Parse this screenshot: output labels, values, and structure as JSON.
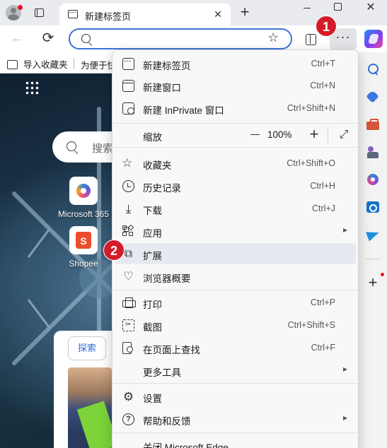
{
  "browser": {
    "tab": {
      "title": "新建标签页",
      "close": "✕"
    },
    "new_tab": "+",
    "window": {
      "close": "✕"
    },
    "toolbar": {
      "back": "←",
      "refresh": "⟳",
      "star": "☆",
      "more": "···"
    }
  },
  "badges": {
    "first": "1",
    "second": "2"
  },
  "favorites_bar": {
    "import_label": "导入收藏夹",
    "link_label": "为便于快"
  },
  "ntp": {
    "search_placeholder": "搜索",
    "tiles": [
      {
        "label": "Microsoft 365",
        "icon": "microsoft-365-icon"
      },
      {
        "label": "Shopee",
        "icon": "shopee-icon",
        "glyph": "S"
      }
    ],
    "feed_tab": "探索"
  },
  "sidebar": {
    "icons": [
      "search-icon",
      "shopping-tag-icon",
      "tools-icon",
      "games-icon",
      "microsoft-365-icon",
      "outlook-icon",
      "send-icon"
    ],
    "add": "+"
  },
  "menu": {
    "items": {
      "new_tab": {
        "label": "新建标签页",
        "shortcut": "Ctrl+T"
      },
      "new_window": {
        "label": "新建窗口",
        "shortcut": "Ctrl+N"
      },
      "new_inprivate": {
        "label": "新建 InPrivate 窗口",
        "shortcut": "Ctrl+Shift+N"
      },
      "zoom": {
        "label": "缩放",
        "value": "100%",
        "minus": "−",
        "plus": "+",
        "fullscreen": "⤢"
      },
      "favorites": {
        "label": "收藏夹",
        "shortcut": "Ctrl+Shift+O"
      },
      "history": {
        "label": "历史记录",
        "shortcut": "Ctrl+H"
      },
      "downloads": {
        "label": "下载",
        "shortcut": "Ctrl+J"
      },
      "apps": {
        "label": "应用",
        "arrow": "▸"
      },
      "extensions": {
        "label": "扩展"
      },
      "essentials": {
        "label": "浏览器概要"
      },
      "print": {
        "label": "打印",
        "shortcut": "Ctrl+P"
      },
      "screenshot": {
        "label": "截图",
        "shortcut": "Ctrl+Shift+S"
      },
      "find": {
        "label": "在页面上查找",
        "shortcut": "Ctrl+F"
      },
      "more_tools": {
        "label": "更多工具",
        "arrow": "▸"
      },
      "settings": {
        "label": "设置"
      },
      "help": {
        "label": "帮助和反馈",
        "arrow": "▸"
      },
      "close_edge": {
        "label": "关闭 Microsoft Edge"
      }
    },
    "highlighted": "extensions"
  },
  "icons": {
    "downloads": "⤓",
    "extensions": "⧉",
    "essentials": "♡",
    "settings": "⚙",
    "help": "?",
    "favorites": "☆"
  },
  "colors": {
    "accent": "#3b74d6",
    "badge": "#d41c29",
    "menu_highlight": "#e6eaf0"
  }
}
